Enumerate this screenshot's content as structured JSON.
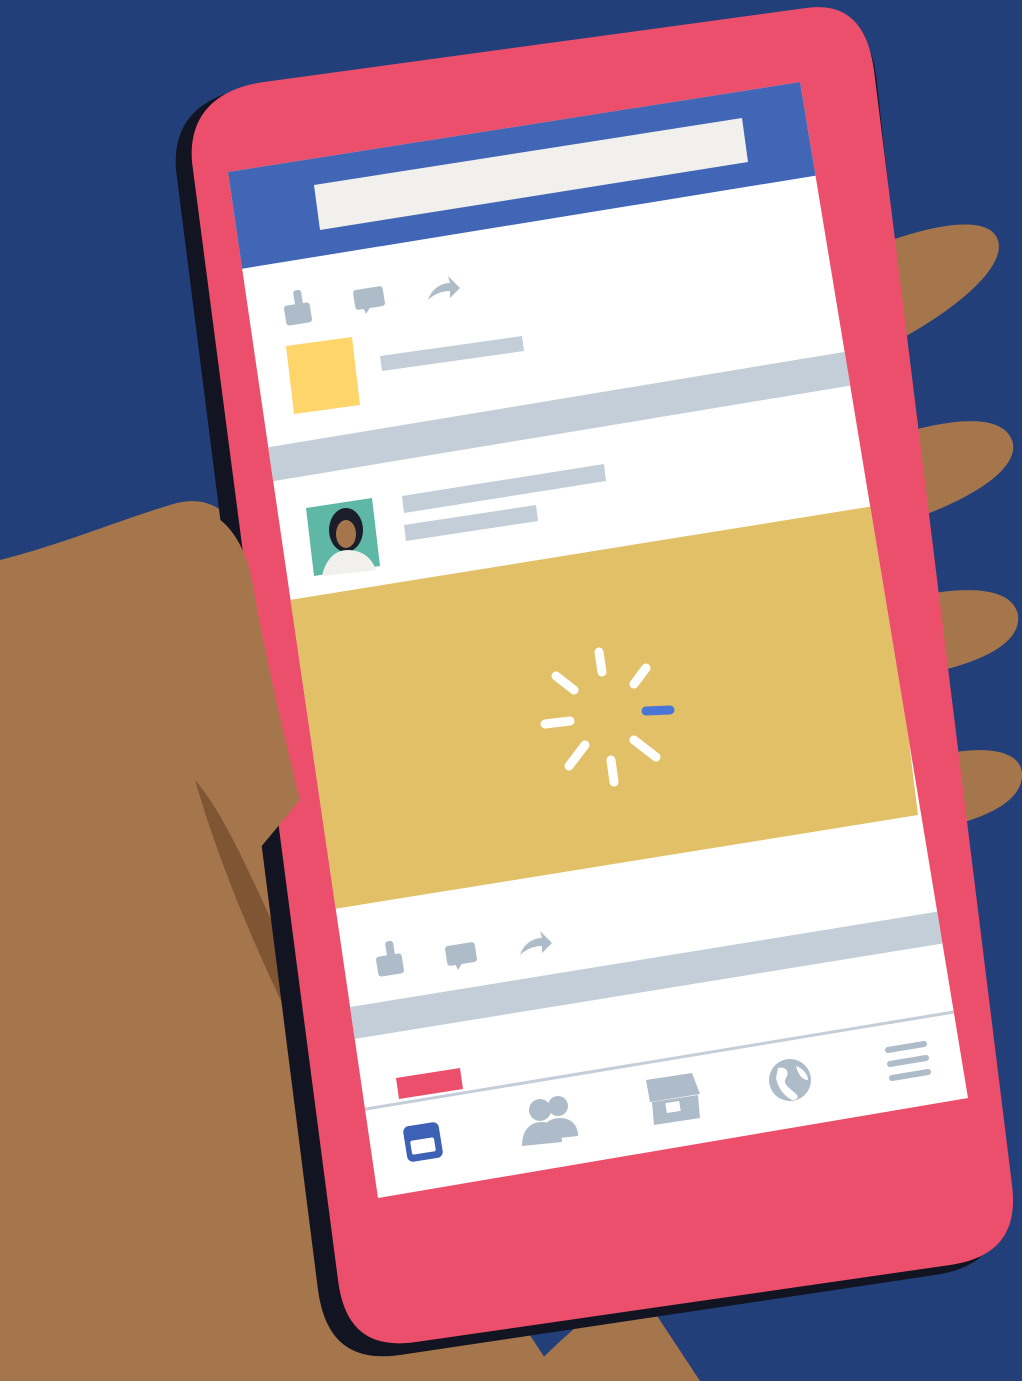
{
  "colors": {
    "background": "#233f7a",
    "skin": "#a5764c",
    "skin_shadow": "#7f5534",
    "phone_body": "#ec4f6b",
    "phone_edge": "#121421",
    "screen": "#ffffff",
    "header_bar": "#4166b6",
    "search_field": "#f2f0ec",
    "placeholder_bar": "#c3ced8",
    "divider": "#c3ced8",
    "icon_gray": "#aebbc8",
    "yellow_thumb": "#fdd56b",
    "media_area": "#e2c067",
    "spinner": "#ffffff",
    "spinner_active": "#4a74d6",
    "avatar_bg": "#5fb8a5",
    "nav_active": "#3d61b4",
    "nav_inactive": "#aebbc8",
    "red_tab": "#ec4f6b"
  },
  "feed": {
    "post_1": {
      "actions": [
        "like-icon",
        "comment-icon",
        "share-icon"
      ],
      "has_thumbnail": true
    },
    "post_2": {
      "has_avatar": true,
      "media_state": "loading",
      "actions": [
        "like-icon",
        "comment-icon",
        "share-icon"
      ]
    }
  },
  "spinner": {
    "segments": 8,
    "active_segment": 2
  },
  "bottom_nav": {
    "items": [
      {
        "icon": "news-feed-icon",
        "active": true
      },
      {
        "icon": "friends-icon",
        "active": false
      },
      {
        "icon": "marketplace-icon",
        "active": false
      },
      {
        "icon": "globe-icon",
        "active": false
      },
      {
        "icon": "menu-icon",
        "active": false
      }
    ]
  }
}
